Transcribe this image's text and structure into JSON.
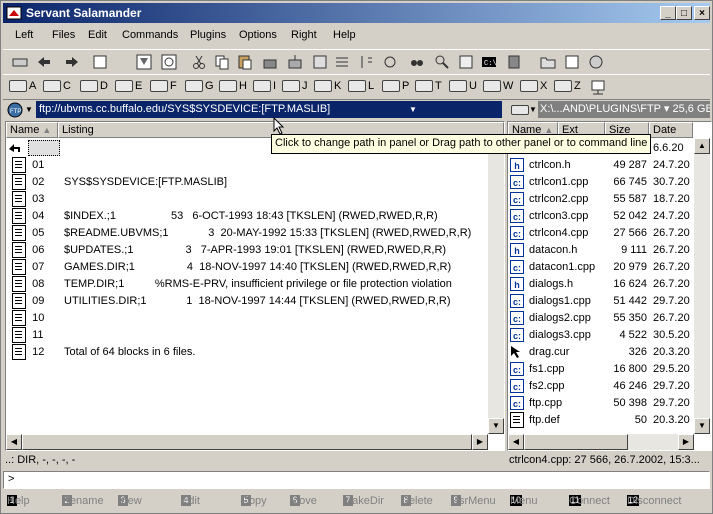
{
  "window": {
    "title": "Servant Salamander",
    "controls": [
      "_",
      "□",
      "×"
    ]
  },
  "menu": [
    "Left",
    "Files",
    "Edit",
    "Commands",
    "Plugins",
    "Options",
    "Right",
    "Help"
  ],
  "drives": [
    "A",
    "C",
    "D",
    "E",
    "F",
    "G",
    "H",
    "I",
    "J",
    "K",
    "L",
    "P",
    "T",
    "U",
    "W",
    "X",
    "Z"
  ],
  "left_panel": {
    "path": "ftp://ubvms.cc.buffalo.edu/SYS$SYSDEVICE:[FTP.MASLIB]",
    "columns": {
      "name": "Name",
      "listing": "Listing"
    },
    "rows": [
      {
        "name": "..",
        "listing": ""
      },
      {
        "name": "01",
        "listing": ""
      },
      {
        "name": "02",
        "listing": "SYS$SYSDEVICE:[FTP.MASLIB]"
      },
      {
        "name": "03",
        "listing": ""
      },
      {
        "name": "04",
        "listing": "$INDEX.;1                  53   6-OCT-1993 18:43 [TKSLEN] (RWED,RWED,R,R)"
      },
      {
        "name": "05",
        "listing": "$README.UBVMS;1             3  20-MAY-1992 15:33 [TKSLEN] (RWED,RWED,R,R)"
      },
      {
        "name": "06",
        "listing": "$UPDATES.;1                 3   7-APR-1993 19:01 [TKSLEN] (RWED,RWED,R,R)"
      },
      {
        "name": "07",
        "listing": "GAMES.DIR;1                 4  18-NOV-1997 14:40 [TKSLEN] (RWED,RWED,R,R)"
      },
      {
        "name": "08",
        "listing": "TEMP.DIR;1          %RMS-E-PRV, insufficient privilege or file protection violation"
      },
      {
        "name": "09",
        "listing": "UTILITIES.DIR;1             1  18-NOV-1997 14:44 [TKSLEN] (RWED,RWED,R,R)"
      },
      {
        "name": "10",
        "listing": ""
      },
      {
        "name": "11",
        "listing": ""
      },
      {
        "name": "12",
        "listing": "Total of 64 blocks in 6 files."
      }
    ],
    "status": "..: DIR, -, -, -, -"
  },
  "right_panel": {
    "path": "X:\\...AND\\PLUGINS\\FTP ▾ 25,6 GB",
    "columns": {
      "name": "Name",
      "ext": "Ext",
      "size": "Size",
      "date": "Date"
    },
    "rows": [
      {
        "icon": "up",
        "name": "..",
        "size": "",
        "date": "6.6.20"
      },
      {
        "icon": "h",
        "name": "ctrlcon.h",
        "size": "49 287",
        "date": "24.7.20"
      },
      {
        "icon": "cpp",
        "name": "ctrlcon1.cpp",
        "size": "66 745",
        "date": "30.7.20"
      },
      {
        "icon": "cpp",
        "name": "ctrlcon2.cpp",
        "size": "55 587",
        "date": "18.7.20"
      },
      {
        "icon": "cpp",
        "name": "ctrlcon3.cpp",
        "size": "52 042",
        "date": "24.7.20"
      },
      {
        "icon": "cpp",
        "name": "ctrlcon4.cpp",
        "size": "27 566",
        "date": "26.7.20"
      },
      {
        "icon": "h",
        "name": "datacon.h",
        "size": "9 111",
        "date": "26.7.20"
      },
      {
        "icon": "cpp",
        "name": "datacon1.cpp",
        "size": "20 979",
        "date": "26.7.20"
      },
      {
        "icon": "h",
        "name": "dialogs.h",
        "size": "16 624",
        "date": "26.7.20"
      },
      {
        "icon": "cpp",
        "name": "dialogs1.cpp",
        "size": "51 442",
        "date": "29.7.20"
      },
      {
        "icon": "cpp",
        "name": "dialogs2.cpp",
        "size": "55 350",
        "date": "26.7.20"
      },
      {
        "icon": "cpp",
        "name": "dialogs3.cpp",
        "size": "4 522",
        "date": "30.5.20"
      },
      {
        "icon": "cur",
        "name": "drag.cur",
        "size": "326",
        "date": "20.3.20"
      },
      {
        "icon": "cpp",
        "name": "fs1.cpp",
        "size": "16 800",
        "date": "29.5.20"
      },
      {
        "icon": "cpp",
        "name": "fs2.cpp",
        "size": "46 246",
        "date": "29.7.20"
      },
      {
        "icon": "cpp",
        "name": "ftp.cpp",
        "size": "50 398",
        "date": "29.7.20"
      },
      {
        "icon": "def",
        "name": "ftp.def",
        "size": "50",
        "date": "20.3.20"
      }
    ],
    "status": "ctrlcon4.cpp: 27 566, 26.7.2002, 15:3..."
  },
  "command_line": {
    "prompt": ">",
    "value": ""
  },
  "tooltip": "Click to change path in panel or Drag path to other panel or to command line",
  "function_keys": [
    {
      "num": "1",
      "label": "Help",
      "active": true
    },
    {
      "num": "2",
      "label": "Rename",
      "active": false
    },
    {
      "num": "3",
      "label": "View",
      "active": false
    },
    {
      "num": "4",
      "label": "Edit",
      "active": false
    },
    {
      "num": "5",
      "label": "Copy",
      "active": false
    },
    {
      "num": "6",
      "label": "Move",
      "active": false
    },
    {
      "num": "7",
      "label": "MakeDir",
      "active": false
    },
    {
      "num": "8",
      "label": "Delete",
      "active": false
    },
    {
      "num": "9",
      "label": "UsrMenu",
      "active": false
    },
    {
      "num": "10",
      "label": "Menu",
      "active": true
    },
    {
      "num": "11",
      "label": "Connect",
      "active": true
    },
    {
      "num": "12",
      "label": "Disconnect",
      "active": true
    }
  ],
  "colors": {
    "title_start": "#0a246a",
    "title_end": "#a6caf0",
    "path_active": "#0a246a"
  }
}
